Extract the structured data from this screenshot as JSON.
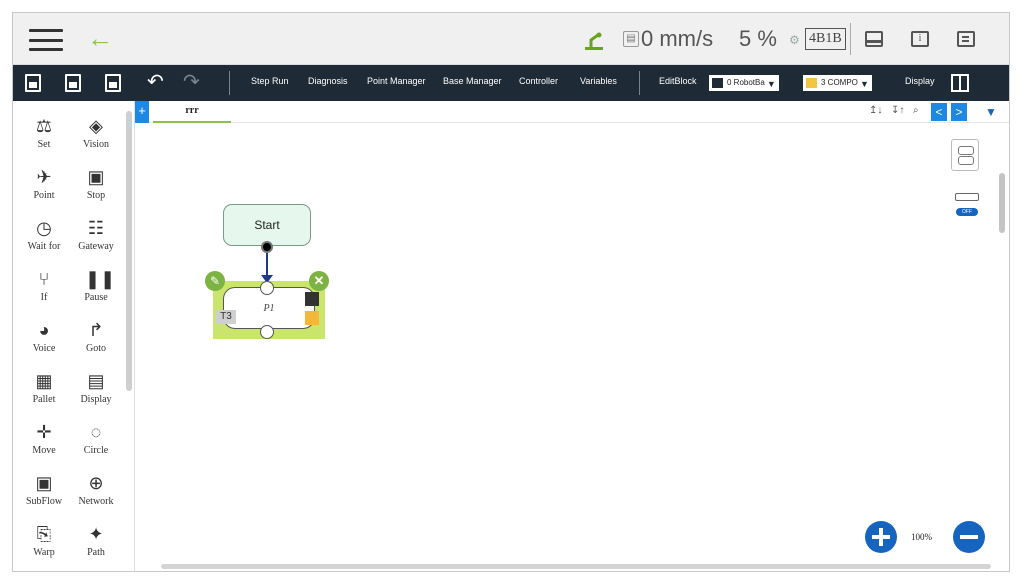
{
  "topbar": {
    "speed": "0 mm/s",
    "speed_percent": "5 %",
    "robot_code": "4B1B"
  },
  "toolbar": {
    "menus": [
      "Step Run",
      "Diagnosis",
      "Point Manager",
      "Base Manager",
      "Controller",
      "Variables",
      "EditBlock"
    ],
    "robot_base_select": "0 RobotBa",
    "tool_select": "3 COMPO",
    "display_label": "Display"
  },
  "palette": {
    "items": [
      {
        "label": "Set",
        "icon": "set-icon",
        "glyph": "⚖"
      },
      {
        "label": "Vision",
        "icon": "vision-icon",
        "glyph": "◈"
      },
      {
        "label": "Point",
        "icon": "point-icon",
        "glyph": "✈"
      },
      {
        "label": "Stop",
        "icon": "stop-icon",
        "glyph": "▣"
      },
      {
        "label": "Wait for",
        "icon": "clock-icon",
        "glyph": "◷"
      },
      {
        "label": "Gateway",
        "icon": "gateway-icon",
        "glyph": "☷"
      },
      {
        "label": "If",
        "icon": "branch-icon",
        "glyph": "⑂"
      },
      {
        "label": "Pause",
        "icon": "pause-icon",
        "glyph": "❚❚"
      },
      {
        "label": "Voice",
        "icon": "voice-icon",
        "glyph": "◕"
      },
      {
        "label": "Goto",
        "icon": "goto-icon",
        "glyph": "↱"
      },
      {
        "label": "Pallet",
        "icon": "pallet-icon",
        "glyph": "▦"
      },
      {
        "label": "Display",
        "icon": "display-icon",
        "glyph": "▤"
      },
      {
        "label": "Move",
        "icon": "move-icon",
        "glyph": "✛"
      },
      {
        "label": "Circle",
        "icon": "circle-icon",
        "glyph": "◌"
      },
      {
        "label": "SubFlow",
        "icon": "subflow-icon",
        "glyph": "▣"
      },
      {
        "label": "Network",
        "icon": "network-icon",
        "glyph": "⊕"
      },
      {
        "label": "Warp",
        "icon": "warp-icon",
        "glyph": "⎘"
      },
      {
        "label": "Path",
        "icon": "path-icon",
        "glyph": "✦"
      }
    ]
  },
  "tabs": {
    "plus": "+",
    "active_tab": "rrr",
    "sort_asc": "↥↓",
    "sort_desc": "↧↑",
    "search": "⌕",
    "prev": "<",
    "next": ">",
    "dropdown": "▼"
  },
  "flow": {
    "start_label": "Start",
    "point_block": {
      "label": "P1",
      "tag": "T3"
    }
  },
  "zoom": {
    "level": "100%"
  },
  "colors": {
    "toolbar_bg": "#1e2a36",
    "accent_green": "#8bc34a",
    "accent_blue": "#1565c0"
  }
}
